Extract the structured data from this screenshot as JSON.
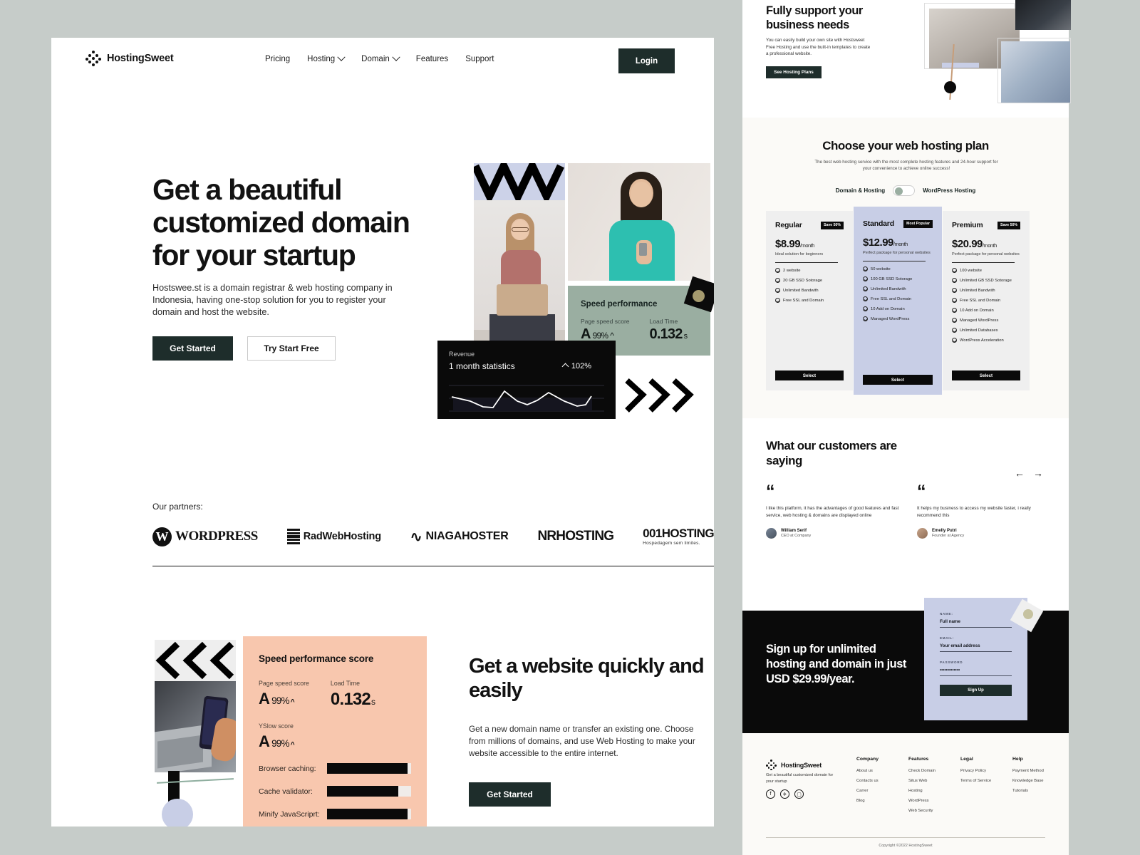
{
  "brand": {
    "name": "HostingSweet",
    "logo_icon": "diamond-dots-icon"
  },
  "nav": {
    "links": [
      {
        "label": "Pricing",
        "has_chevron": false
      },
      {
        "label": "Hosting",
        "has_chevron": true
      },
      {
        "label": "Domain",
        "has_chevron": true
      },
      {
        "label": "Features",
        "has_chevron": false
      },
      {
        "label": "Support",
        "has_chevron": false
      }
    ],
    "login_label": "Login"
  },
  "hero": {
    "title": "Get a beautiful customized domain for your startup",
    "subtitle": "Hostswee.st is a domain registrar & web hosting company in Indonesia, having one-stop solution for you to register your domain and host the website.",
    "primary_cta": "Get Started",
    "secondary_cta": "Try Start Free",
    "speed_card": {
      "title": "Speed performance",
      "metric1_label": "Page speed score",
      "metric1_grade": "A",
      "metric1_value": "99%",
      "metric2_label": "Load Time",
      "metric2_value": "0.132",
      "metric2_unit": "s"
    },
    "revenue_card": {
      "label": "Revenue",
      "subtitle": "1 month statistics",
      "change": "102%"
    }
  },
  "partners": {
    "label": "Our partners:",
    "items": [
      {
        "name": "WORDPRESS",
        "icon": "wordpress-icon"
      },
      {
        "name": "RadWebHosting",
        "icon": "radwebhosting-icon"
      },
      {
        "name": "NIAGAHOSTER",
        "icon": "niagahoster-icon"
      },
      {
        "name": "NRHOSTING",
        "icon": "nrhosting-icon"
      },
      {
        "name": "001HOSTING",
        "tagline": "Hospedagem sem limites.",
        "icon": "001hosting-icon"
      }
    ]
  },
  "speed_score_card": {
    "title": "Speed performance score",
    "page_speed_label": "Page speed score",
    "page_speed_grade": "A",
    "page_speed_value": "99%",
    "load_time_label": "Load Time",
    "load_time_value": "0.132",
    "load_time_unit": "s",
    "yslow_label": "YSlow score",
    "yslow_grade": "A",
    "yslow_value": "99%",
    "bars": [
      {
        "label": "Browser caching:",
        "percent": 96
      },
      {
        "label": "Cache validator:",
        "percent": 85
      },
      {
        "label": "Minify JavaScriprt:",
        "percent": 96
      }
    ]
  },
  "section2": {
    "title": "Get a website quickly and easily",
    "subtitle": "Get a new domain name or transfer an existing one. Choose from millions of domains, and use Web Hosting to make your website accessible to the entire internet.",
    "cta": "Get Started"
  },
  "support_section": {
    "title": "Fully support your business needs",
    "subtitle": "You can easily build your own site with Hostsweet Free Hosting and use the built-in templates to create a professional website.",
    "cta": "See Hosting Plans"
  },
  "pricing": {
    "title": "Choose your web hosting plan",
    "subtitle": "The best web hosting service with the most complete hosting features and 24-hour support for your convenience to achieve online success!",
    "toggle_left": "Domain & Hosting",
    "toggle_right": "WordPress Hosting",
    "select_label": "Select",
    "plans": [
      {
        "name": "Regular",
        "badge": "Save 50%",
        "price": "$8.99",
        "period": "/month",
        "desc": "Ideal solution for beginners",
        "features": [
          "2 website",
          "20 GB SSD Sotorage",
          "Unlimited Bandwith",
          "Free SSL and Domain"
        ]
      },
      {
        "name": "Standard",
        "badge": "Most Popular",
        "price": "$12.99",
        "period": "/month",
        "desc": "Perfect package for personal websites",
        "features": [
          "50 website",
          "100 GB SSD Sotorage",
          "Unlimited Bandwith",
          "Free SSL and Domain",
          "10 Add on Domain",
          "Managed WordPress"
        ]
      },
      {
        "name": "Premium",
        "badge": "Save 50%",
        "price": "$20.99",
        "period": "/month",
        "desc": "Perfect package for personal websites",
        "features": [
          "100 website",
          "Unlimited GB SSD Sotorage",
          "Unlimited Bandwith",
          "Free SSL and Domain",
          "10 Add on Domain",
          "Managed WordPress",
          "Unlimited Databases",
          "WordPress Acceleration"
        ]
      }
    ]
  },
  "testimonials": {
    "title": "What our customers are saying",
    "prev_icon": "arrow-left-icon",
    "next_icon": "arrow-right-icon",
    "items": [
      {
        "quote": "I like this platform, it has the advantages of good features and fast service, web hosting & domains are displayed online",
        "name": "William Serif",
        "role": "CEO at Company"
      },
      {
        "quote": "It helps my business to access my website faster, i really recommend this",
        "name": "Emelly Putri",
        "role": "Founder at Agency"
      }
    ]
  },
  "signup": {
    "title": "Sign up for unlimited hosting and domain in just USD $29.99/year.",
    "fields": [
      {
        "label": "NAME:",
        "value": "Full name"
      },
      {
        "label": "EMAIL:",
        "value": "Your email address"
      },
      {
        "label": "PASSWORD",
        "value": "•••••••••••••"
      }
    ],
    "cta": "Sign Up"
  },
  "footer": {
    "brand": "HostingSweet",
    "tagline": "Get a beautiful customized domain for your startup",
    "socials": [
      {
        "icon": "facebook-icon",
        "glyph": "f"
      },
      {
        "icon": "twitter-icon",
        "glyph": "✈"
      },
      {
        "icon": "instagram-icon",
        "glyph": "▢"
      }
    ],
    "columns": [
      {
        "heading": "Company",
        "items": [
          "About us",
          "Contacts us",
          "Carrer",
          "Blog"
        ]
      },
      {
        "heading": "Features",
        "items": [
          "Check Domain",
          "Situs Web",
          "Hosting",
          "WordPress",
          "Web Security"
        ]
      },
      {
        "heading": "Legal",
        "items": [
          "Privacy Policy",
          "Terms of Service"
        ]
      },
      {
        "heading": "Help",
        "items": [
          "Payment Method",
          "Knowledge Base",
          "Tutorials"
        ]
      }
    ],
    "copyright": "Copyright ©2022 HostingSweet"
  },
  "colors": {
    "dark": "#1e2d2b",
    "black": "#0a0a0a",
    "peach": "#f8c7ae",
    "sage": "#9aaea1",
    "periwinkle": "#c8cee6",
    "cream": "#fbfaf7"
  }
}
